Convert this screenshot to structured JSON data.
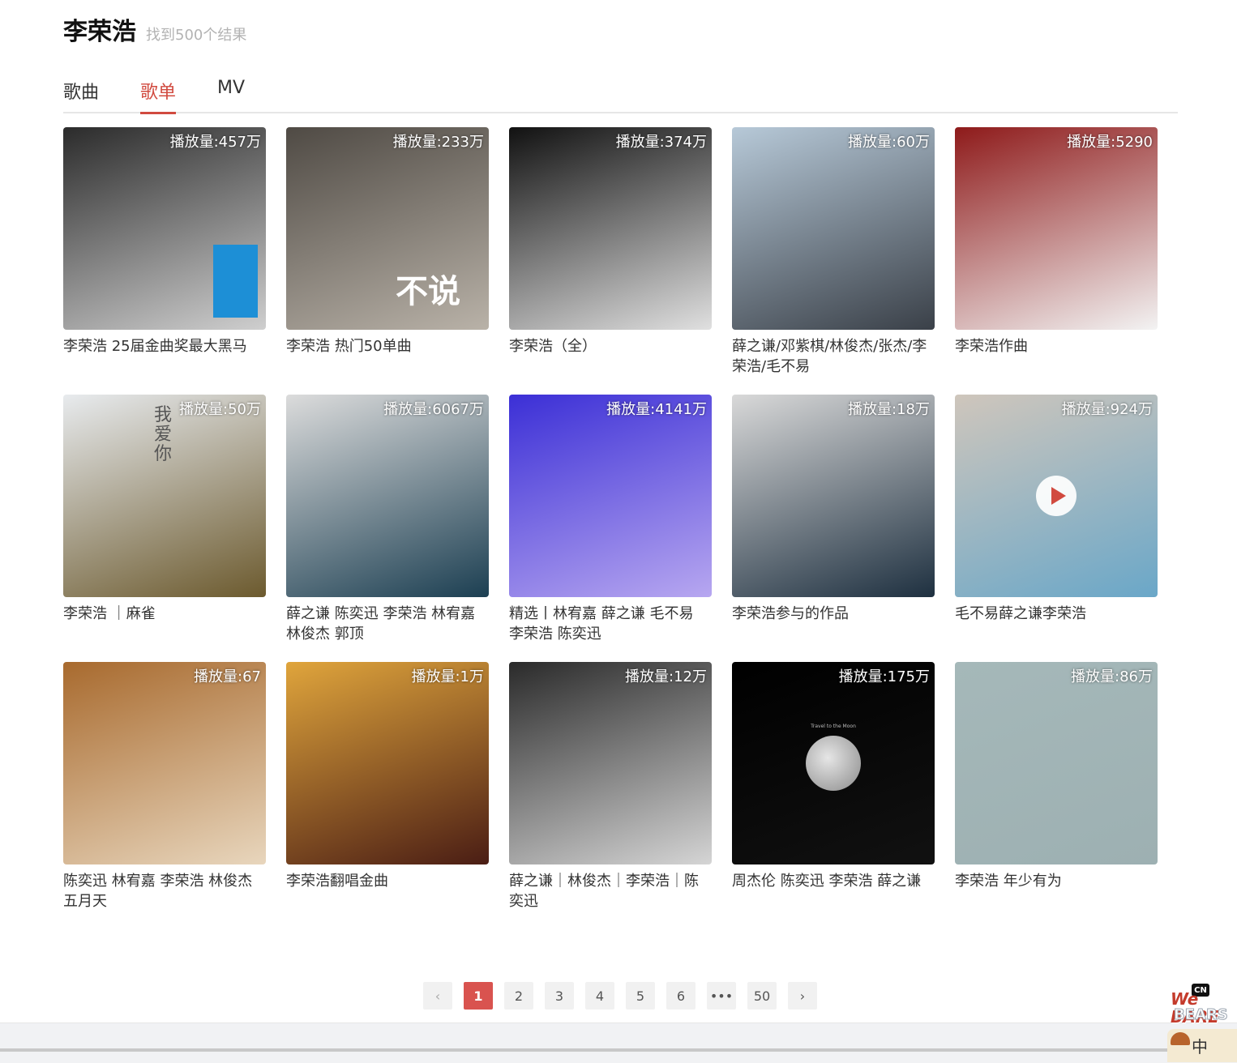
{
  "header": {
    "query": "李荣浩",
    "result_count": "找到500个结果"
  },
  "tabs": [
    {
      "label": "歌曲",
      "active": false
    },
    {
      "label": "歌单",
      "active": true
    },
    {
      "label": "MV",
      "active": false
    }
  ],
  "playlists": [
    {
      "plays": "播放量:457万",
      "title": "李荣浩 25届金曲奖最大黑马"
    },
    {
      "plays": "播放量:233万",
      "title": "李荣浩 热门50单曲"
    },
    {
      "plays": "播放量:374万",
      "title": "李荣浩（全）"
    },
    {
      "plays": "播放量:60万",
      "title": "薛之谦/邓紫棋/林俊杰/张杰/李荣浩/毛不易"
    },
    {
      "plays": "播放量:5290",
      "title": "李荣浩作曲"
    },
    {
      "plays": "播放量:50万",
      "title": "李荣浩 ｜麻雀"
    },
    {
      "plays": "播放量:6067万",
      "title": "薛之谦 陈奕迅 李荣浩 林宥嘉 林俊杰 郭顶"
    },
    {
      "plays": "播放量:4141万",
      "title": "精选丨林宥嘉 薛之谦 毛不易 李荣浩 陈奕迅"
    },
    {
      "plays": "播放量:18万",
      "title": "李荣浩参与的作品"
    },
    {
      "plays": "播放量:924万",
      "title": "毛不易薛之谦李荣浩"
    },
    {
      "plays": "播放量:67",
      "title": "陈奕迅 林宥嘉 李荣浩 林俊杰 五月天"
    },
    {
      "plays": "播放量:1万",
      "title": "李荣浩翻唱金曲"
    },
    {
      "plays": "播放量:12万",
      "title": "薛之谦｜林俊杰｜李荣浩｜陈奕迅"
    },
    {
      "plays": "播放量:175万",
      "title": "周杰伦 陈奕迅 李荣浩 薛之谦"
    },
    {
      "plays": "播放量:86万",
      "title": "李荣浩 年少有为"
    }
  ],
  "covers": [
    {
      "name": "cover-bw-portrait",
      "colors": [
        "#2b2b2b",
        "#cfcfcf"
      ],
      "accent": "#1d8fd6"
    },
    {
      "name": "cover-buyue",
      "colors": [
        "#4f4a44",
        "#b9b2a8"
      ],
      "accent": "#ffffff",
      "text": "不说"
    },
    {
      "name": "cover-bw-hands",
      "colors": [
        "#111111",
        "#e0e0e0"
      ]
    },
    {
      "name": "cover-snow-book",
      "colors": [
        "#b7c9d8",
        "#3a4048"
      ]
    },
    {
      "name": "cover-red-couple",
      "colors": [
        "#8e1a1a",
        "#f3f3f3"
      ]
    },
    {
      "name": "cover-mountain-lake",
      "colors": [
        "#e8ebee",
        "#6c5a2e"
      ],
      "text": "我爱你"
    },
    {
      "name": "cover-room-lamp",
      "colors": [
        "#dcdcdc",
        "#1c3f52"
      ]
    },
    {
      "name": "cover-blue-stage",
      "colors": [
        "#3b2fd6",
        "#b7a7f0"
      ]
    },
    {
      "name": "cover-suit",
      "colors": [
        "#d9d9d9",
        "#1e3040"
      ]
    },
    {
      "name": "cover-floral-shirt",
      "colors": [
        "#cfc6bc",
        "#6aa7c8"
      ],
      "play_button": true
    },
    {
      "name": "cover-hug",
      "colors": [
        "#a86a2e",
        "#e8d6bd"
      ]
    },
    {
      "name": "cover-gold-stage",
      "colors": [
        "#e0a53c",
        "#4a1d14"
      ]
    },
    {
      "name": "cover-anime-bw",
      "colors": [
        "#2a2a2a",
        "#d5d5d5"
      ]
    },
    {
      "name": "cover-moon",
      "colors": [
        "#000000",
        "#111111"
      ],
      "text": "Travel to the Moon"
    },
    {
      "name": "cover-sky-branch",
      "colors": [
        "#a5b8b9",
        "#9db0b2"
      ]
    }
  ],
  "pagination": {
    "prev": "‹",
    "pages": [
      "1",
      "2",
      "3",
      "4",
      "5",
      "6",
      "•••",
      "50"
    ],
    "active": "1",
    "next": "›"
  },
  "mascot": {
    "badge": "CN",
    "logo_line1": "We BARE",
    "logo_line2": "BEARS",
    "lang": "中"
  }
}
